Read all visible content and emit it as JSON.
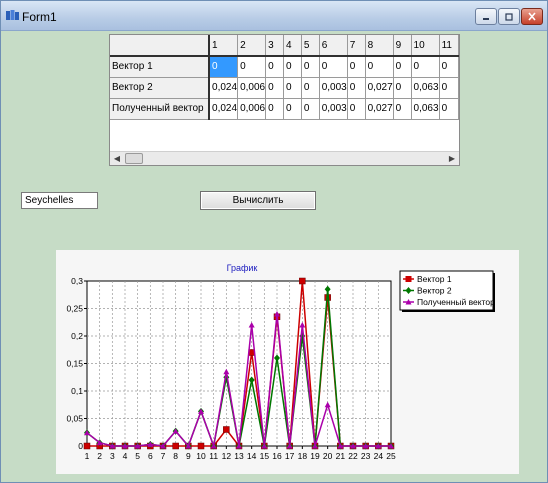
{
  "window": {
    "title": "Form1",
    "colors": {
      "client_bg": "#c6dcc6",
      "selection": "#3399ff"
    }
  },
  "grid": {
    "columns": [
      "",
      "1",
      "2",
      "3",
      "4",
      "5",
      "6",
      "7",
      "8",
      "9",
      "10",
      "11"
    ],
    "rows": [
      {
        "label": "Вектор 1",
        "cells": [
          "0",
          "0",
          "0",
          "0",
          "0",
          "0",
          "0",
          "0",
          "0",
          "0",
          "0"
        ]
      },
      {
        "label": "Вектор 2",
        "cells": [
          "0,024",
          "0,006",
          "0",
          "0",
          "0",
          "0,003",
          "0",
          "0,027",
          "0",
          "0,063",
          "0"
        ]
      },
      {
        "label": "Полученный вектор",
        "cells": [
          "0,024",
          "0,006",
          "0",
          "0",
          "0",
          "0,003",
          "0",
          "0,027",
          "0",
          "0,063",
          "0"
        ]
      }
    ],
    "selected_cell": {
      "row": 0,
      "col": 0
    }
  },
  "input": {
    "value": "Seychelles"
  },
  "button": {
    "label": "Вычислить"
  },
  "chart_data": {
    "type": "line",
    "title": "График",
    "x": [
      1,
      2,
      3,
      4,
      5,
      6,
      7,
      8,
      9,
      10,
      11,
      12,
      13,
      14,
      15,
      16,
      17,
      18,
      19,
      20,
      21,
      22,
      23,
      24,
      25
    ],
    "ylim": [
      0,
      0.3
    ],
    "yticks": [
      "0",
      "0,05",
      "0,1",
      "0,15",
      "0,2",
      "0,25",
      "0,3"
    ],
    "ytick_values": [
      0,
      0.05,
      0.1,
      0.15,
      0.2,
      0.25,
      0.3
    ],
    "grid": true,
    "legend": "top-right",
    "series": [
      {
        "name": "Вектор 1",
        "color": "#cc0000",
        "marker": "square",
        "values": [
          0,
          0,
          0,
          0,
          0,
          0,
          0,
          0,
          0,
          0,
          0,
          0.03,
          0,
          0.17,
          0,
          0.235,
          0,
          0.3,
          0,
          0.27,
          0,
          0,
          0,
          0,
          0
        ]
      },
      {
        "name": "Вектор 2",
        "color": "#007700",
        "marker": "diamond",
        "values": [
          0.024,
          0.006,
          0,
          0,
          0,
          0.003,
          0,
          0.027,
          0,
          0.063,
          0,
          0.125,
          0,
          0.12,
          0,
          0.16,
          0,
          0.2,
          0,
          0.285,
          0,
          0,
          0,
          0,
          0
        ]
      },
      {
        "name": "Полученный вектор",
        "color": "#aa00aa",
        "marker": "triangle",
        "values": [
          0.024,
          0.006,
          0,
          0,
          0,
          0.003,
          0,
          0.027,
          0,
          0.063,
          0,
          0.135,
          0,
          0.22,
          0,
          0.24,
          0,
          0.22,
          0,
          0.075,
          0,
          0,
          0,
          0,
          0
        ]
      }
    ]
  }
}
